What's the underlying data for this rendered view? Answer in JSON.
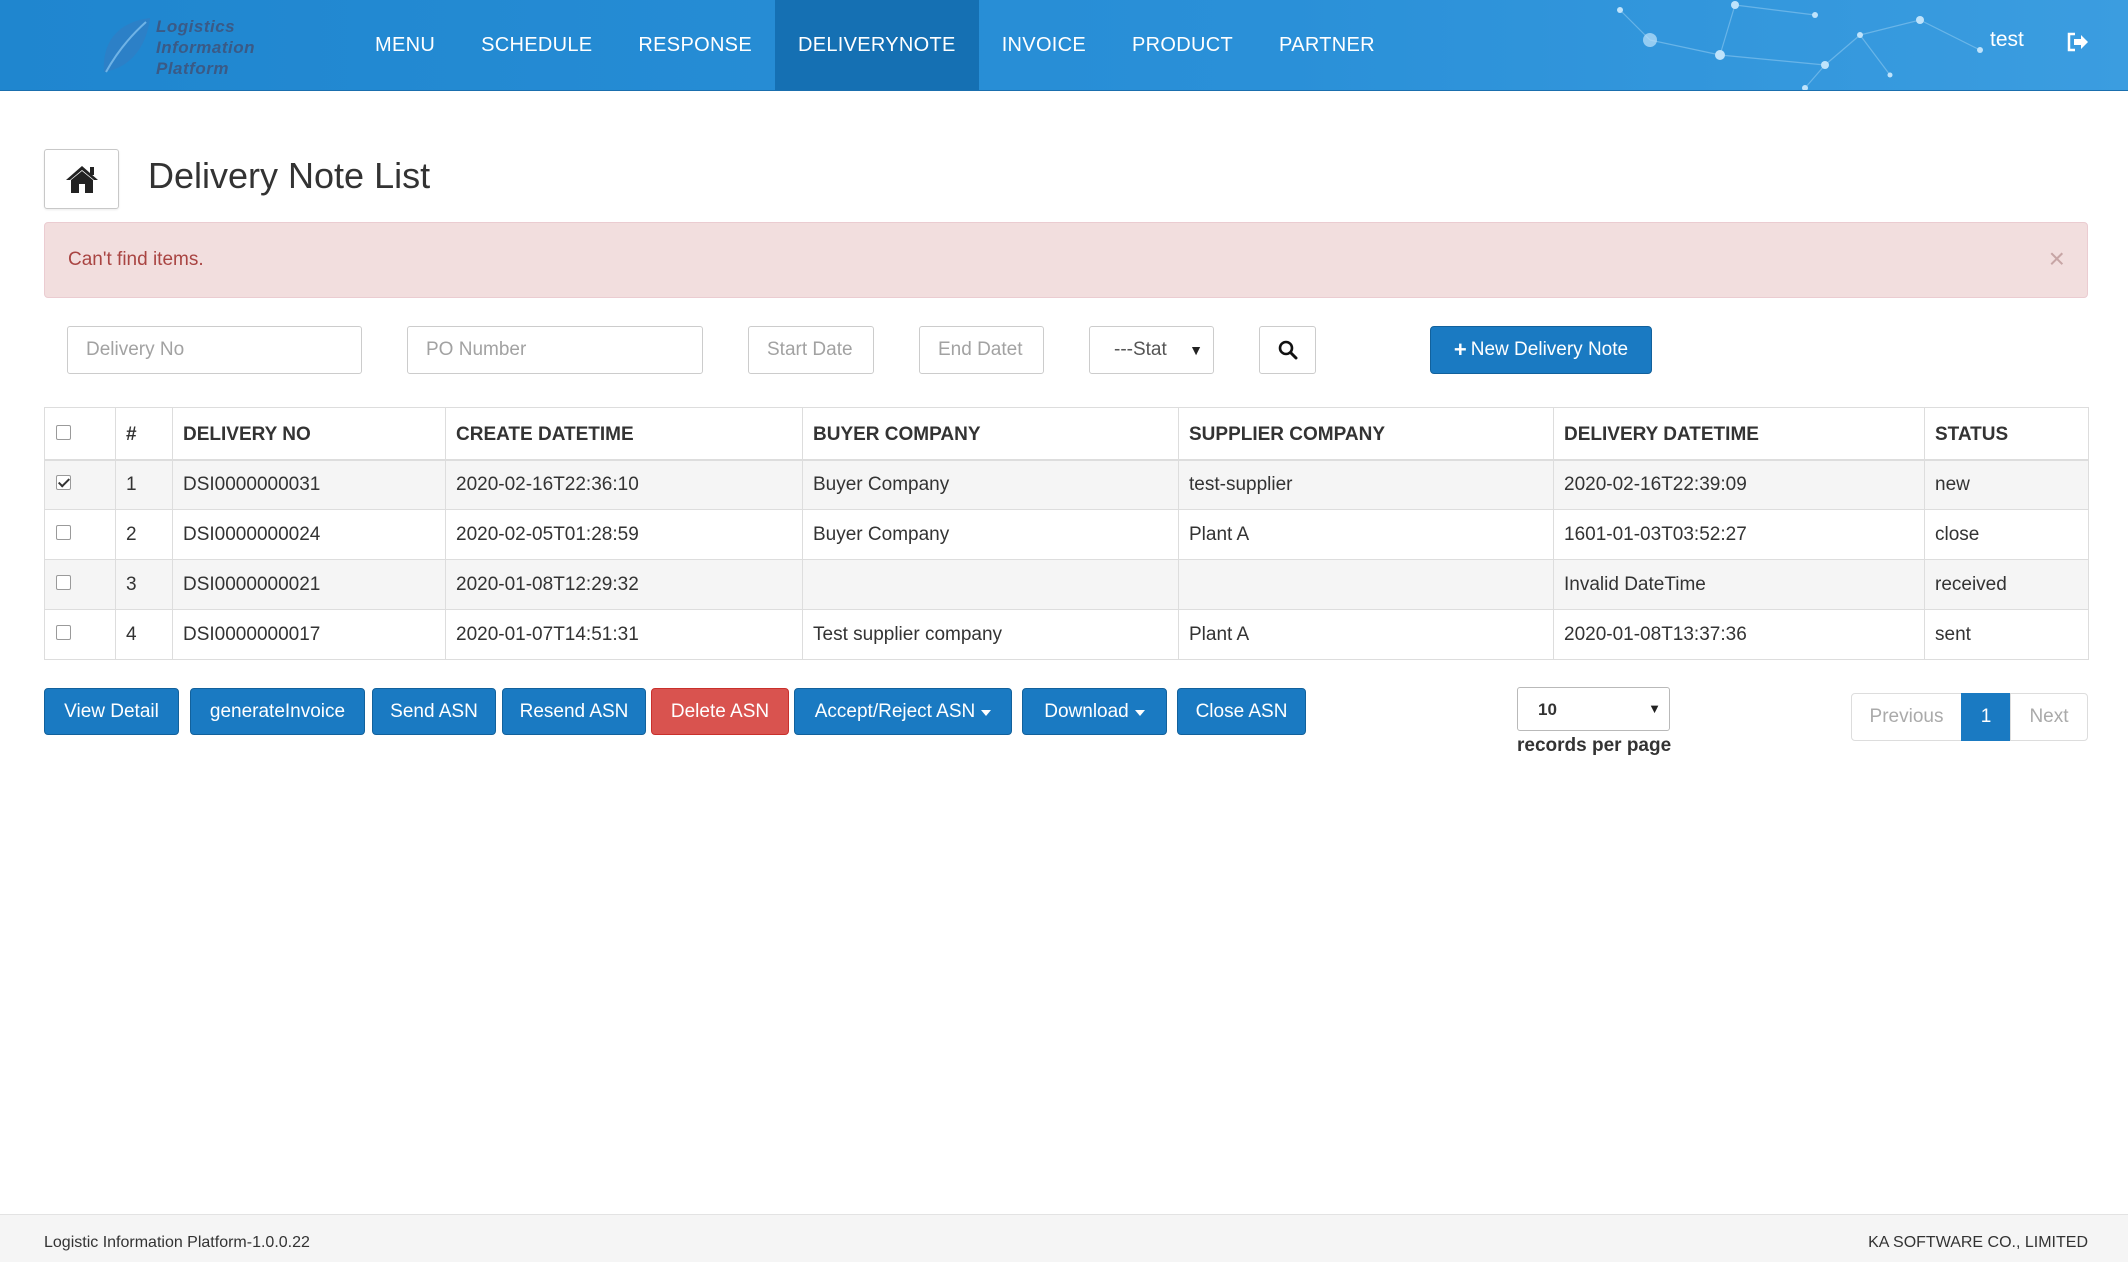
{
  "nav": {
    "logo_lines": [
      "Logistics",
      "Information",
      "Platform"
    ],
    "items": [
      {
        "label": "MENU",
        "active": false
      },
      {
        "label": "SCHEDULE",
        "active": false
      },
      {
        "label": "RESPONSE",
        "active": false
      },
      {
        "label": "DELIVERYNOTE",
        "active": true
      },
      {
        "label": "INVOICE",
        "active": false
      },
      {
        "label": "PRODUCT",
        "active": false
      },
      {
        "label": "PARTNER",
        "active": false
      }
    ],
    "user": "test",
    "logout_icon": "sign-out-icon"
  },
  "header": {
    "home_icon": "home-icon",
    "title": "Delivery Note List"
  },
  "alert": {
    "message": "Can't find items.",
    "close": "×"
  },
  "filters": {
    "delivery_no_placeholder": "Delivery No",
    "po_number_placeholder": "PO Number",
    "start_date_placeholder": "Start Date",
    "end_date_placeholder": "End Datet",
    "status_selected": "---Stat",
    "search_icon": "search-icon",
    "new_button_label": "New Delivery Note"
  },
  "table": {
    "headers": [
      "#",
      "DELIVERY NO",
      "CREATE DATETIME",
      "BUYER COMPANY",
      "SUPPLIER COMPANY",
      "DELIVERY DATETIME",
      "STATUS"
    ],
    "rows": [
      {
        "checked": true,
        "cells": [
          "1",
          "DSI0000000031",
          "2020-02-16T22:36:10",
          "Buyer Company",
          "test-supplier",
          "2020-02-16T22:39:09",
          "new"
        ]
      },
      {
        "checked": false,
        "cells": [
          "2",
          "DSI0000000024",
          "2020-02-05T01:28:59",
          "Buyer Company",
          "Plant A",
          "1601-01-03T03:52:27",
          "close"
        ]
      },
      {
        "checked": false,
        "cells": [
          "3",
          "DSI0000000021",
          "2020-01-08T12:29:32",
          "",
          "",
          "Invalid DateTime",
          "received"
        ]
      },
      {
        "checked": false,
        "cells": [
          "4",
          "DSI0000000017",
          "2020-01-07T14:51:31",
          "Test supplier company",
          "Plant A",
          "2020-01-08T13:37:36",
          "sent"
        ]
      }
    ]
  },
  "actions": {
    "view_detail": "View Detail",
    "generate_invoice": "generateInvoice",
    "send_asn": "Send ASN",
    "resend_asn": "Resend ASN",
    "delete_asn": "Delete ASN",
    "accept_reject_asn": "Accept/Reject ASN",
    "download": "Download",
    "close_asn": "Close ASN"
  },
  "paging": {
    "page_size": "10",
    "page_size_label": "records per page",
    "previous": "Previous",
    "current": "1",
    "next": "Next"
  },
  "footer": {
    "left": "Logistic Information Platform-1.0.0.22",
    "right": "KA SOFTWARE CO., LIMITED"
  },
  "colors": {
    "navbar": "#2a90d8",
    "nav_active": "#1570b3",
    "primary_button": "#1a7ac2",
    "danger_button": "#d9534f",
    "alert_bg": "#f2dede",
    "alert_text": "#a94442"
  }
}
